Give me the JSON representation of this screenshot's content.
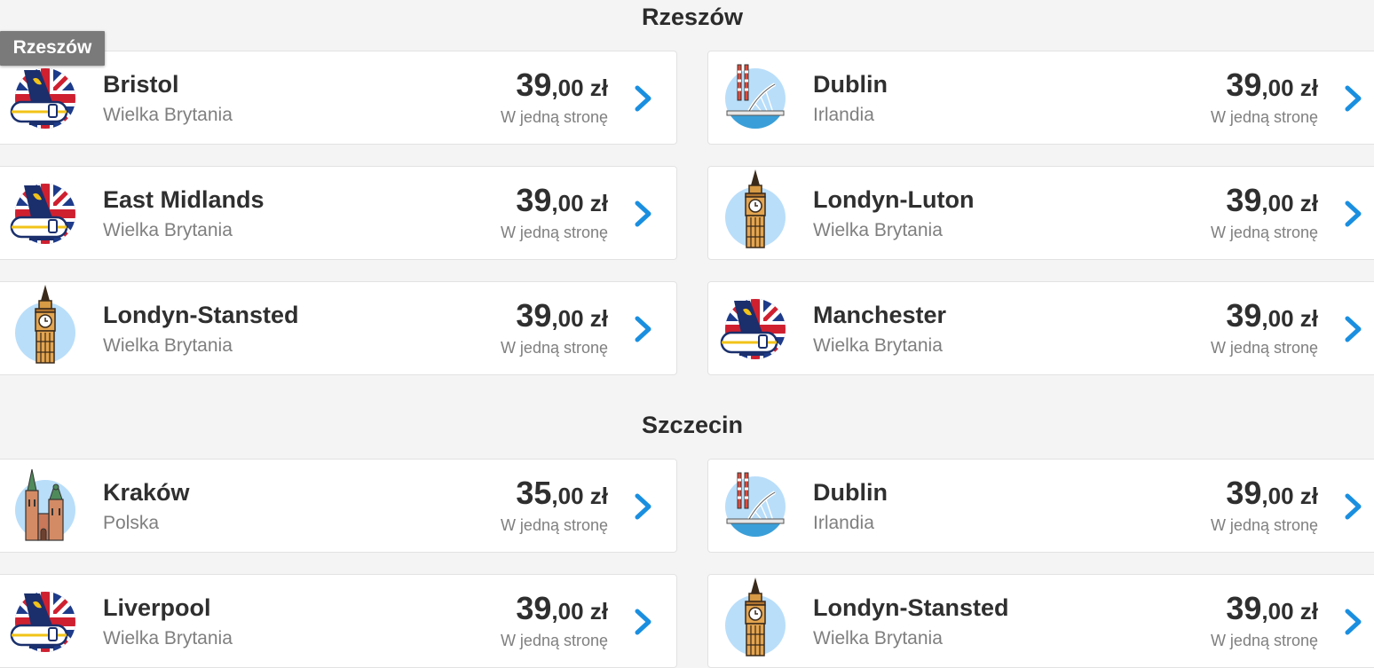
{
  "tooltip": "Rzeszów",
  "sections": [
    {
      "title": "Rzeszów",
      "routes": [
        {
          "city": "Bristol",
          "country": "Wielka Brytania",
          "price_whole": "39",
          "price_dec": ",00 zł",
          "fare": "W jedną stronę",
          "icon": "ryanair-uk-flag-icon"
        },
        {
          "city": "Dublin",
          "country": "Irlandia",
          "price_whole": "39",
          "price_dec": ",00 zł",
          "fare": "W jedną stronę",
          "icon": "dublin-bridge-icon"
        },
        {
          "city": "East Midlands",
          "country": "Wielka Brytania",
          "price_whole": "39",
          "price_dec": ",00 zł",
          "fare": "W jedną stronę",
          "icon": "ryanair-uk-flag-icon"
        },
        {
          "city": "Londyn-Luton",
          "country": "Wielka Brytania",
          "price_whole": "39",
          "price_dec": ",00 zł",
          "fare": "W jedną stronę",
          "icon": "big-ben-icon"
        },
        {
          "city": "Londyn-Stansted",
          "country": "Wielka Brytania",
          "price_whole": "39",
          "price_dec": ",00 zł",
          "fare": "W jedną stronę",
          "icon": "big-ben-icon"
        },
        {
          "city": "Manchester",
          "country": "Wielka Brytania",
          "price_whole": "39",
          "price_dec": ",00 zł",
          "fare": "W jedną stronę",
          "icon": "ryanair-uk-flag-icon"
        }
      ]
    },
    {
      "title": "Szczecin",
      "routes": [
        {
          "city": "Kraków",
          "country": "Polska",
          "price_whole": "35",
          "price_dec": ",00 zł",
          "fare": "W jedną stronę",
          "icon": "krakow-church-icon"
        },
        {
          "city": "Dublin",
          "country": "Irlandia",
          "price_whole": "39",
          "price_dec": ",00 zł",
          "fare": "W jedną stronę",
          "icon": "dublin-bridge-icon"
        },
        {
          "city": "Liverpool",
          "country": "Wielka Brytania",
          "price_whole": "39",
          "price_dec": ",00 zł",
          "fare": "W jedną stronę",
          "icon": "ryanair-uk-flag-icon"
        },
        {
          "city": "Londyn-Stansted",
          "country": "Wielka Brytania",
          "price_whole": "39",
          "price_dec": ",00 zł",
          "fare": "W jedną stronę",
          "icon": "big-ben-icon"
        }
      ]
    }
  ],
  "colors": {
    "chevron": "#1a8fe0",
    "page_bg": "#f4f4f4",
    "icon_bg": "#b9defa",
    "ryanair_blue": "#1a2f6c",
    "flag_red": "#cf2030"
  }
}
